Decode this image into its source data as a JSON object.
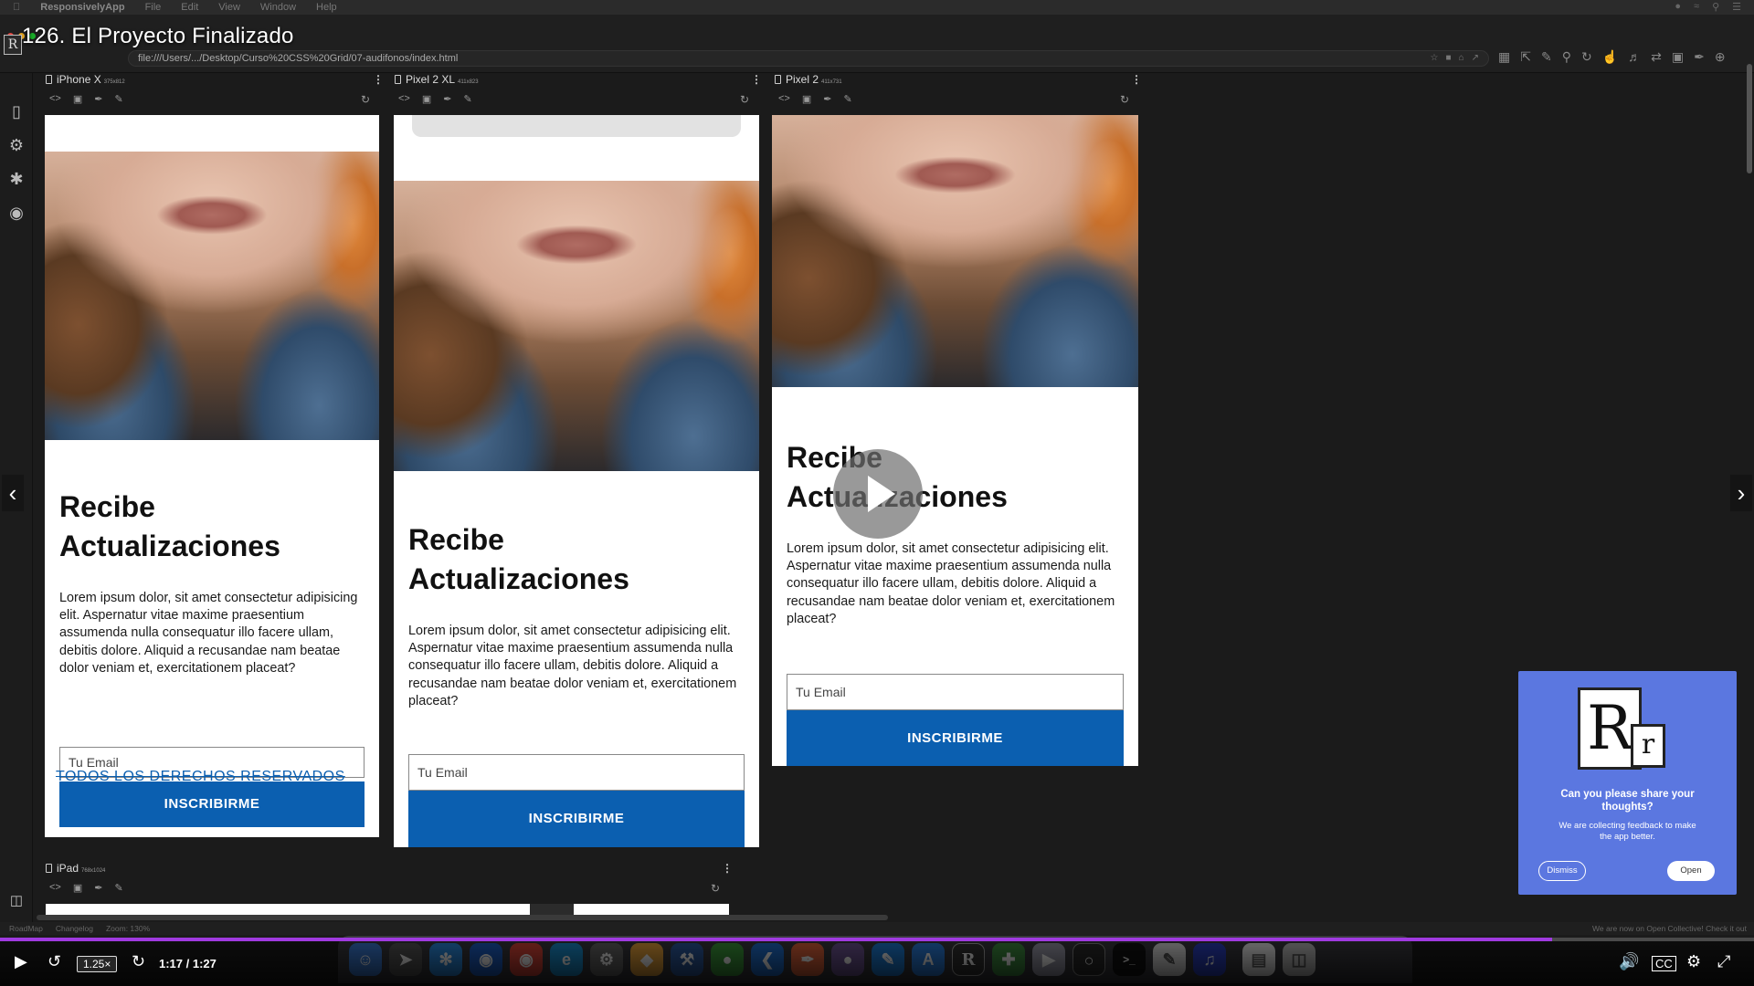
{
  "video": {
    "title": "126. El Proyecto Finalizado",
    "speed": "1.25×",
    "time": "1:17 / 1:27",
    "progress": 0.885
  },
  "menubar": {
    "app_name": "ResponsivelyApp",
    "items": [
      "File",
      "Edit",
      "View",
      "Window",
      "Help"
    ]
  },
  "address": {
    "url": "file:///Users/.../Desktop/Curso%20CSS%20Grid/07-audifonos/index.html"
  },
  "devices": [
    {
      "name": "iPhone X",
      "res": "375x812"
    },
    {
      "name": "Pixel 2 XL",
      "res": "411x823"
    },
    {
      "name": "Pixel 2",
      "res": "411x731"
    },
    {
      "name": "iPad",
      "res": "768x1024"
    }
  ],
  "page": {
    "heading_line1": "Recibe",
    "heading_line2": "Actualizaciones",
    "body": "Lorem ipsum dolor, sit amet consectetur adipisicing elit. Aspernatur vitae maxime praesentium assumenda nulla consequatur illo facere ullam, debitis dolore. Aliquid a recusandae nam beatae dolor veniam et, exercitationem placeat?",
    "email_placeholder": "Tu Email",
    "button": "INSCRIBIRME",
    "footer": "TODOS LOS DERECHOS RESERVADOS"
  },
  "feedback": {
    "logo_big": "R",
    "logo_small": "r",
    "title": "Can you please share your thoughts?",
    "subtitle": "We are collecting feedback to make the app better.",
    "dismiss": "Dismiss",
    "open": "Open"
  },
  "statusbar": {
    "roadmap": "RoadMap",
    "changelog": "Changelog",
    "zoom": "Zoom: 130%",
    "right": "We are now on Open Collective! Check it out"
  },
  "colors": {
    "accent_blue": "#0b5fb0",
    "feedback_bg": "#5b77e0",
    "progress": "#a03ae0"
  }
}
